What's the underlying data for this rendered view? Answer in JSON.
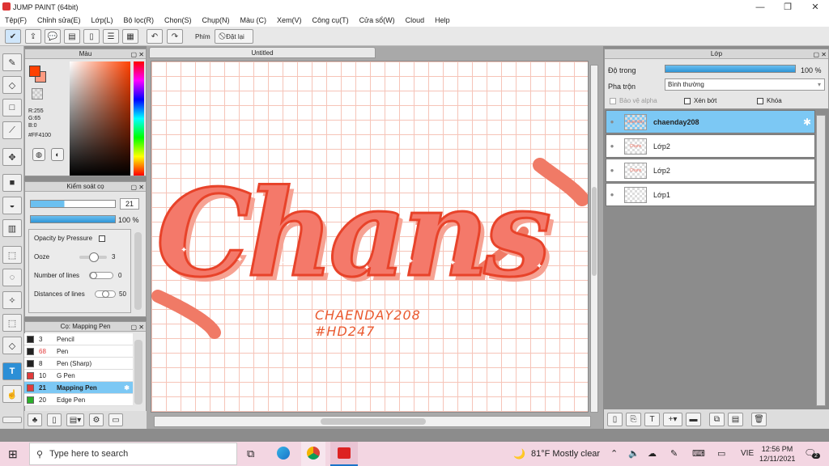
{
  "window": {
    "title": "JUMP PAINT (64bit)"
  },
  "menu": [
    "Tệp(F)",
    "Chỉnh sửa(E)",
    "Lớp(L)",
    "Bộ lọc(R)",
    "Chọn(S)",
    "Chụp(N)",
    "Màu (C)",
    "Xem(V)",
    "Công cụ(T)",
    "Cửa sổ(W)",
    "Cloud",
    "Help"
  ],
  "toolbar": {
    "phim_label": "Phím",
    "reset_label": "Đặt lại"
  },
  "color_panel": {
    "title": "Màu",
    "r": "R:255",
    "g": "G:65",
    "b": "B:0",
    "hex": "#FF4100",
    "fg_color": "#FF4100",
    "bg_color": "#FF9A80"
  },
  "brush_panel": {
    "title": "Kiểm soát cọ",
    "size_value": "21",
    "opacity_value": "100 %",
    "opacity_pressure_label": "Opacity by Pressure",
    "ooze_label": "Ooze",
    "ooze_value": "3",
    "lines_label": "Number of lines",
    "lines_value": "0",
    "distance_label": "Distances of lines",
    "distance_value": "50"
  },
  "pen_panel": {
    "title": "Cọ: Mapping Pen",
    "pens": [
      {
        "size": "3",
        "name": "Pencil",
        "color": "#222222"
      },
      {
        "size": "68",
        "name": "Pen",
        "color": "#222222"
      },
      {
        "size": "8",
        "name": "Pen (Sharp)",
        "color": "#222222"
      },
      {
        "size": "10",
        "name": "G Pen",
        "color": "#e23b3b"
      },
      {
        "size": "21",
        "name": "Mapping Pen",
        "color": "#e23b3b"
      },
      {
        "size": "20",
        "name": "Edge Pen",
        "color": "#2bb02b"
      }
    ]
  },
  "canvas": {
    "tab_title": "Untitled",
    "art_text": "Chans",
    "credit_line1": "CHAENDAY208",
    "credit_line2": "#HD247"
  },
  "layer_panel": {
    "title": "Lớp",
    "opacity_label": "Độ trong",
    "opacity_value": "100 %",
    "blend_label": "Pha trộn",
    "blend_value": "Bình thường",
    "protect_alpha": "Bảo vệ alpha",
    "clip": "Xén bớt",
    "lock": "Khóa",
    "layers": [
      {
        "name": "chaenday208",
        "thumb": "chaenday"
      },
      {
        "name": "Lớp2",
        "thumb": "Chans"
      },
      {
        "name": "Lớp2",
        "thumb": "Chans"
      },
      {
        "name": "Lớp1",
        "thumb": ""
      }
    ]
  },
  "taskbar": {
    "search_placeholder": "Type here to search",
    "weather": "81°F  Mostly clear",
    "lang": "VIE",
    "time": "12:56 PM",
    "date": "12/11/2021",
    "notif_count": "2"
  }
}
